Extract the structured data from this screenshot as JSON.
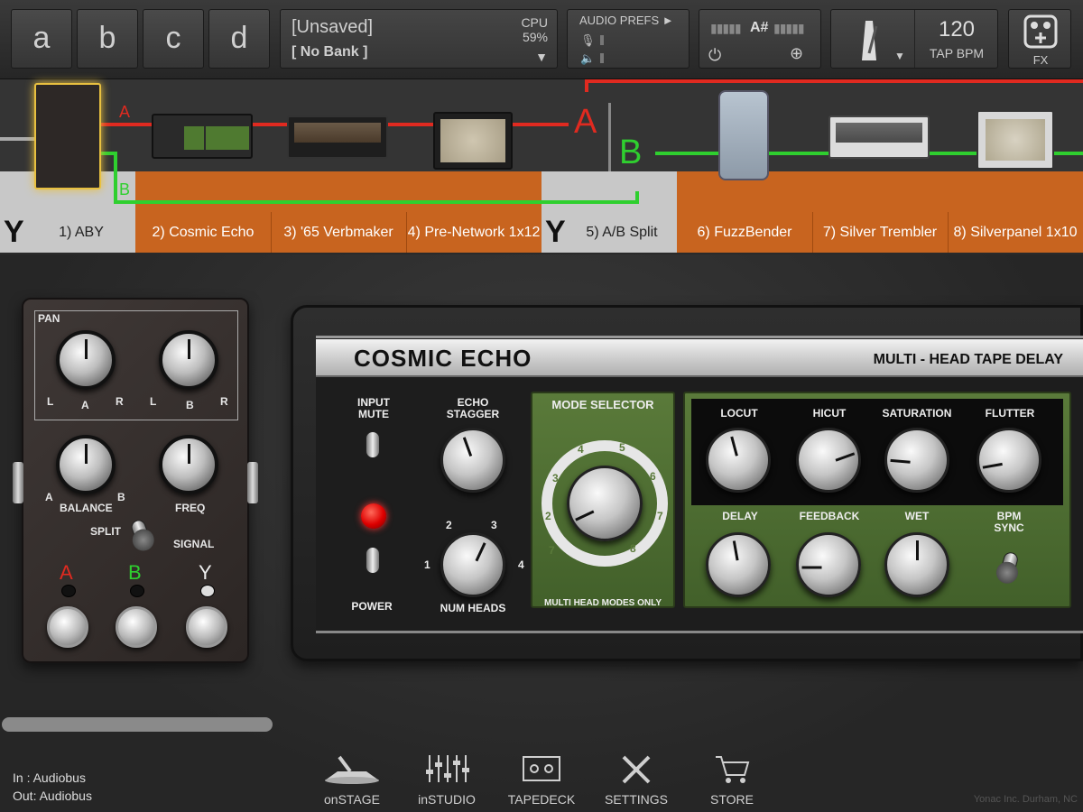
{
  "presets": [
    "a",
    "b",
    "c",
    "d"
  ],
  "preset_panel": {
    "name": "[Unsaved]",
    "bank": "[ No Bank ]",
    "cpu_label": "CPU",
    "cpu_value": "59%"
  },
  "audio_prefs": {
    "label": "AUDIO PREFS ►"
  },
  "tuner": {
    "note": "A#"
  },
  "tempo": {
    "bpm": "120",
    "tap_label": "TAP BPM"
  },
  "fx": {
    "label": "FX"
  },
  "chain": {
    "branch_labels": {
      "a": "A",
      "b": "B"
    },
    "split_labels": {
      "a": "A",
      "b": "B"
    },
    "y_marker": "Y",
    "slots": [
      {
        "label": "1) ABY",
        "color": "#c8c8c8"
      },
      {
        "label": "2) Cosmic Echo",
        "color": "#c8641f"
      },
      {
        "label": "3) '65 Verbmaker",
        "color": "#c8641f"
      },
      {
        "label": "4) Pre-Network 1x12",
        "color": "#c8641f"
      },
      {
        "label": "5) A/B Split",
        "color": "#c8c8c8"
      },
      {
        "label": "6) FuzzBender",
        "color": "#c8641f"
      },
      {
        "label": "7) Silver Trembler",
        "color": "#c8641f"
      },
      {
        "label": "8) Silverpanel 1x10",
        "color": "#c8641f"
      }
    ]
  },
  "aby": {
    "pan_label": "PAN",
    "knob_a_label": "A",
    "knob_b_label": "B",
    "l": "L",
    "r": "R",
    "balance_label": "BALANCE",
    "balance_a": "A",
    "balance_b": "B",
    "freq_label": "FREQ",
    "split_label": "SPLIT",
    "signal_label": "SIGNAL",
    "foot_a": "A",
    "foot_b": "B",
    "foot_y": "Y"
  },
  "echo": {
    "title": "COSMIC ECHO",
    "subtitle": "MULTI - HEAD TAPE DELAY",
    "input_mute": "INPUT MUTE",
    "power": "POWER",
    "echo_stagger": "ECHO STAGGER",
    "num_heads": "NUM HEADS",
    "num_heads_ticks": [
      "1",
      "2",
      "3",
      "4"
    ],
    "mode_selector": "MODE SELECTOR",
    "mode_ticks": [
      "1",
      "2",
      "3",
      "4",
      "5",
      "6",
      "7",
      "8",
      "7"
    ],
    "multi_head_only": "MULTI HEAD MODES ONLY",
    "top_knobs": [
      "LOCUT",
      "HICUT",
      "SATURATION",
      "FLUTTER"
    ],
    "bottom_knobs": [
      "DELAY",
      "FEEDBACK",
      "WET"
    ],
    "bpm_sync": "BPM SYNC"
  },
  "nav": [
    "onSTAGE",
    "inSTUDIO",
    "TAPEDECK",
    "SETTINGS",
    "STORE"
  ],
  "io": {
    "in": "In   : Audiobus",
    "out": "Out: Audiobus"
  },
  "footer": "Yonac Inc. Durham, NC"
}
